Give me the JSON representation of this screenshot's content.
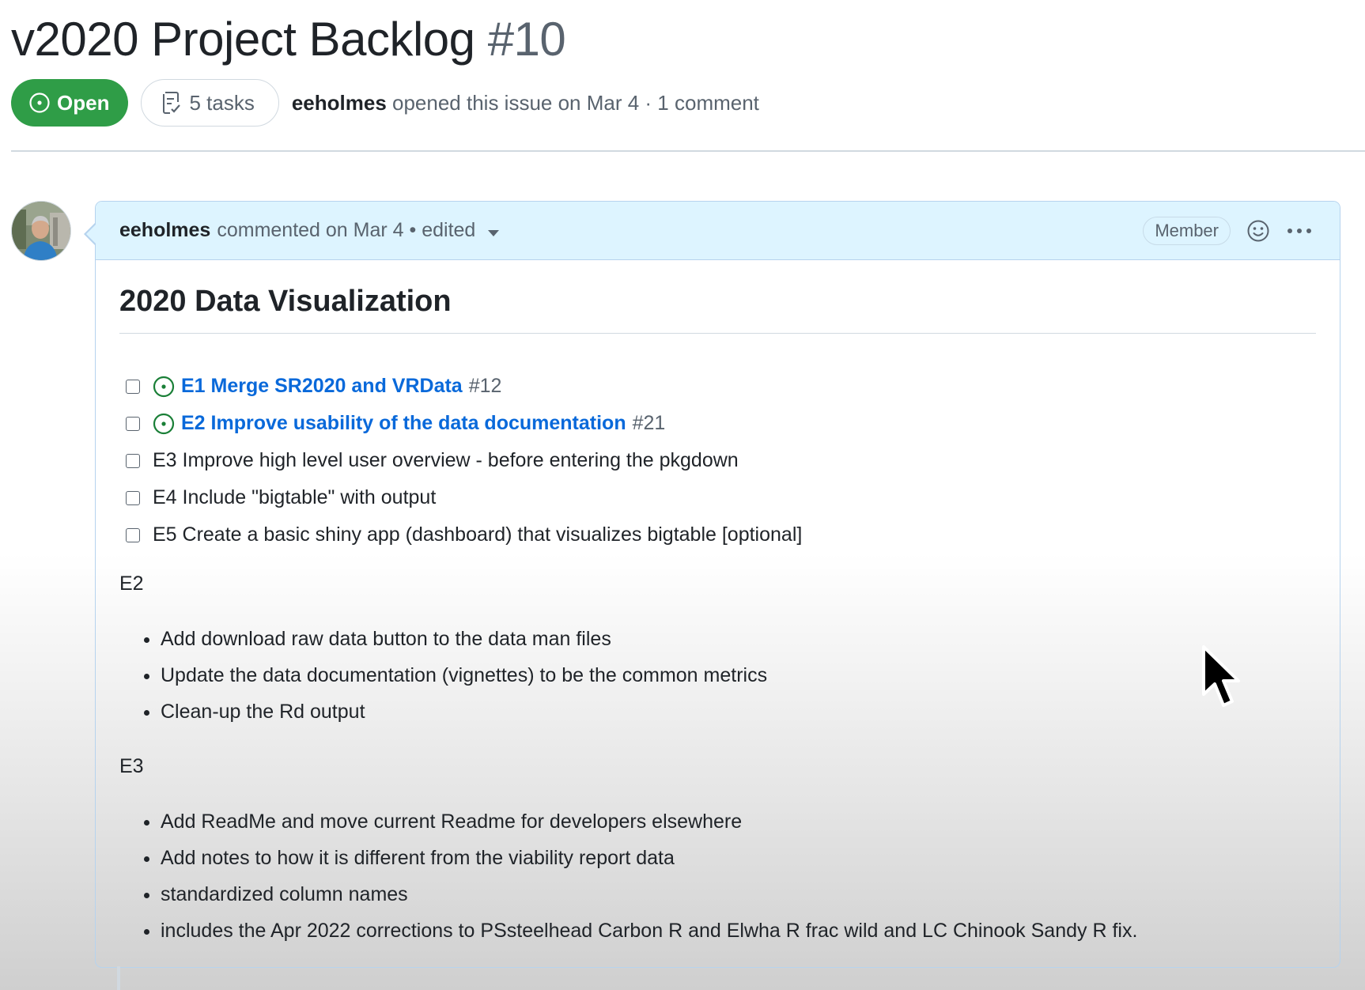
{
  "issue": {
    "title": "v2020 Project Backlog",
    "number": "#10",
    "state": "Open",
    "tasks_label": "5 tasks",
    "author": "eeholmes",
    "meta_text": " opened this issue on Mar 4 · 1 comment"
  },
  "comment": {
    "author": "eeholmes",
    "header_text": "commented on Mar 4 • edited",
    "role_badge": "Member",
    "heading": "2020 Data Visualization",
    "tasks": [
      {
        "link": "E1 Merge SR2020 and VRData",
        "ref": "#12"
      },
      {
        "link": "E2 Improve usability of the data documentation",
        "ref": "#21"
      },
      {
        "text": "E3 Improve high level user overview - before entering the pkgdown"
      },
      {
        "text": "E4 Include \"bigtable\" with output"
      },
      {
        "text": "E5 Create a basic shiny app (dashboard) that visualizes bigtable [optional]"
      }
    ],
    "sections": [
      {
        "label": "E2",
        "items": [
          "Add download raw data button to the data man files",
          "Update the data documentation (vignettes) to be the common metrics",
          "Clean-up the Rd output"
        ]
      },
      {
        "label": "E3",
        "items": [
          "Add ReadMe and move current Readme for developers elsewhere",
          "Add notes to how it is different from the viability report data",
          "standardized column names",
          "includes the Apr 2022 corrections to PSsteelhead Carbon R and Elwha R frac wild and LC Chinook Sandy R fix."
        ]
      }
    ]
  },
  "icons": {
    "state": "issue-opened-icon",
    "tasks": "checklist-icon",
    "reaction": "smiley-icon",
    "more": "kebab-horizontal-icon"
  },
  "colors": {
    "open_green": "#2f9d47",
    "link_blue": "#0969da",
    "header_bg": "#ddf4ff",
    "header_border": "#b6d3ee"
  }
}
